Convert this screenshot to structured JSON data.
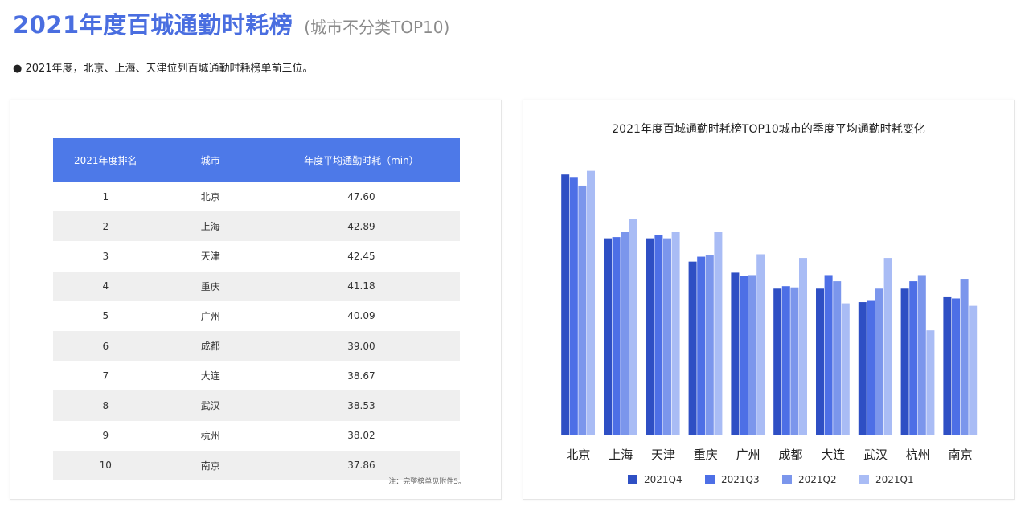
{
  "header": {
    "title": "2021年度百城通勤时耗榜",
    "subtitle": "(城市不分类TOP10)"
  },
  "bullet_text": "● 2021年度，北京、上海、天津位列百城通勤时耗榜单前三位。",
  "table": {
    "columns": [
      "2021年度排名",
      "城市",
      "年度平均通勤时耗（min）"
    ],
    "rows": [
      {
        "rank": "1",
        "city": "北京",
        "value": "47.60"
      },
      {
        "rank": "2",
        "city": "上海",
        "value": "42.89"
      },
      {
        "rank": "3",
        "city": "天津",
        "value": "42.45"
      },
      {
        "rank": "4",
        "city": "重庆",
        "value": "41.18"
      },
      {
        "rank": "5",
        "city": "广州",
        "value": "40.09"
      },
      {
        "rank": "6",
        "city": "成都",
        "value": "39.00"
      },
      {
        "rank": "7",
        "city": "大连",
        "value": "38.67"
      },
      {
        "rank": "8",
        "city": "武汉",
        "value": "38.53"
      },
      {
        "rank": "9",
        "city": "杭州",
        "value": "38.02"
      },
      {
        "rank": "10",
        "city": "南京",
        "value": "37.86"
      }
    ],
    "footnote": "注：完整榜单见附件5。"
  },
  "colors": {
    "title": "#4a6ee0",
    "table_header": "#4d79e8",
    "q4": "#2e4fc4",
    "q3": "#4d6fe6",
    "q2": "#7b96ec",
    "q1": "#a9bcf5"
  },
  "chart_data": {
    "type": "bar",
    "title": "2021年度百城通勤时耗榜TOP10城市的季度平均通勤时耗变化",
    "categories": [
      "北京",
      "上海",
      "天津",
      "重庆",
      "广州",
      "成都",
      "大连",
      "武汉",
      "杭州",
      "南京"
    ],
    "series": [
      {
        "name": "2021Q4",
        "color": "#2e4fc4",
        "values": [
          48.2,
          43.0,
          43.0,
          41.1,
          40.2,
          38.9,
          38.9,
          37.8,
          38.9,
          38.2
        ]
      },
      {
        "name": "2021Q3",
        "color": "#4d6fe6",
        "values": [
          48.0,
          43.1,
          43.3,
          41.5,
          39.9,
          39.1,
          40.0,
          37.9,
          39.5,
          38.1
        ]
      },
      {
        "name": "2021Q2",
        "color": "#7b96ec",
        "values": [
          47.3,
          43.5,
          43.0,
          41.6,
          40.0,
          39.0,
          39.5,
          38.9,
          40.0,
          39.7
        ]
      },
      {
        "name": "2021Q1",
        "color": "#a9bcf5",
        "values": [
          48.5,
          44.6,
          43.5,
          43.5,
          41.7,
          41.4,
          37.7,
          41.4,
          35.5,
          37.5
        ]
      }
    ],
    "ylim": [
      27.0,
      49.0
    ],
    "xlabel": "",
    "ylabel": "",
    "grid": false,
    "legend": "bottom"
  }
}
